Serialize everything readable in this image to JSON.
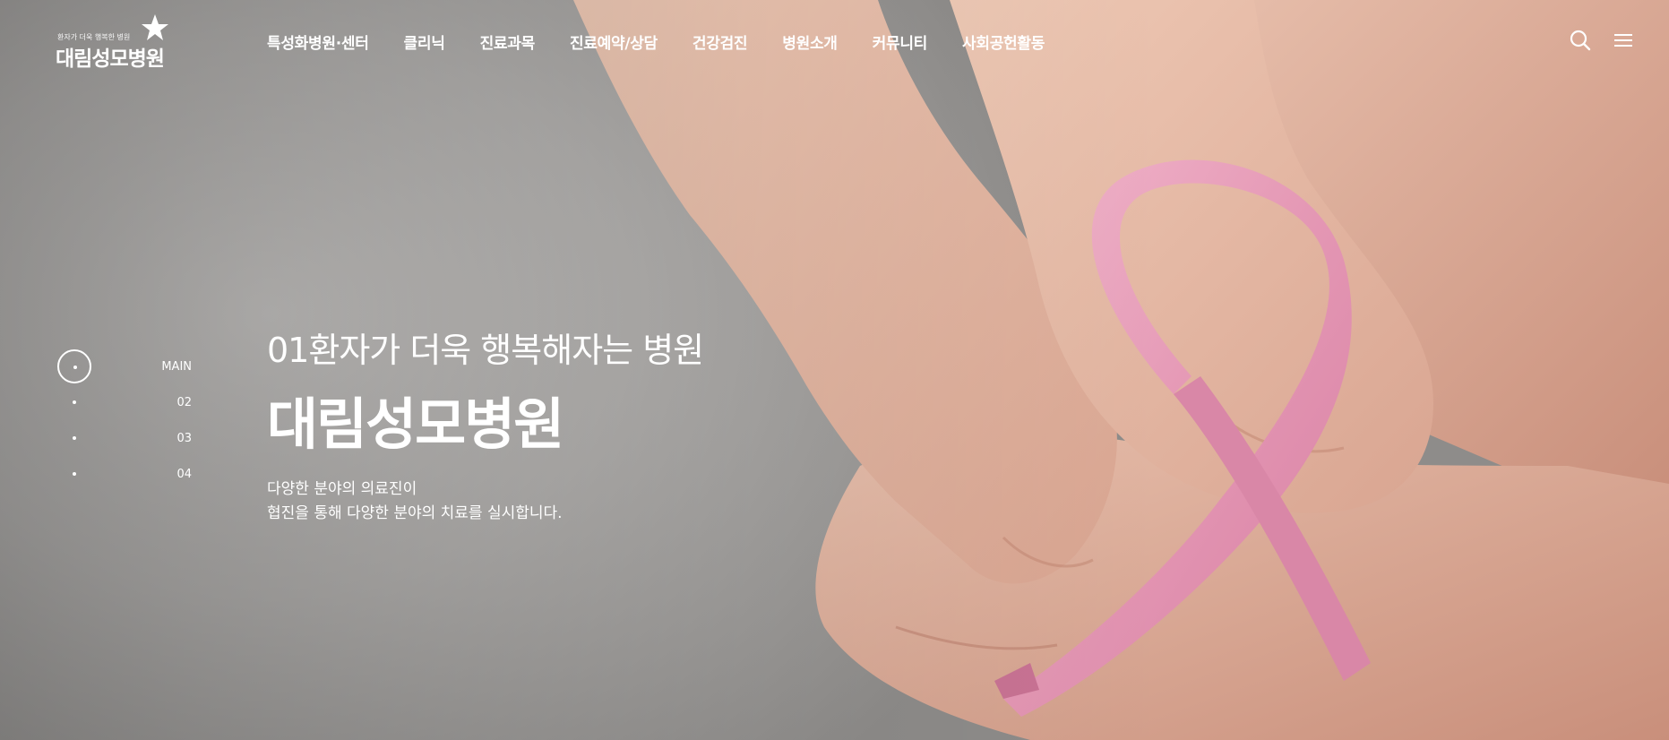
{
  "logo": {
    "tagline": "환자가 더욱 행복한 병원",
    "name": "대림성모병원"
  },
  "nav": {
    "items": [
      "특성화병원·센터",
      "클리닉",
      "진료과목",
      "진료예약/상담",
      "건강검진",
      "병원소개",
      "커뮤니티",
      "사회공헌활동"
    ]
  },
  "header_icons": {
    "search": "search-icon",
    "menu": "hamburger-menu-icon"
  },
  "pager": {
    "items": [
      "MAIN",
      "02",
      "03",
      "04"
    ],
    "active": 0
  },
  "hero": {
    "subtitle": "01환자가 더욱 행복해자는 병원",
    "title": "대림성모병원",
    "desc_line1": "다양한 분야의 의료진이",
    "desc_line2": "협진을 통해 다양한 분야의 치료를 실시합니다."
  },
  "colors": {
    "text": "#ffffff",
    "ribbon": "#e8a3bd",
    "background": "#b7b5b3",
    "skin": "#e9c2ad"
  }
}
